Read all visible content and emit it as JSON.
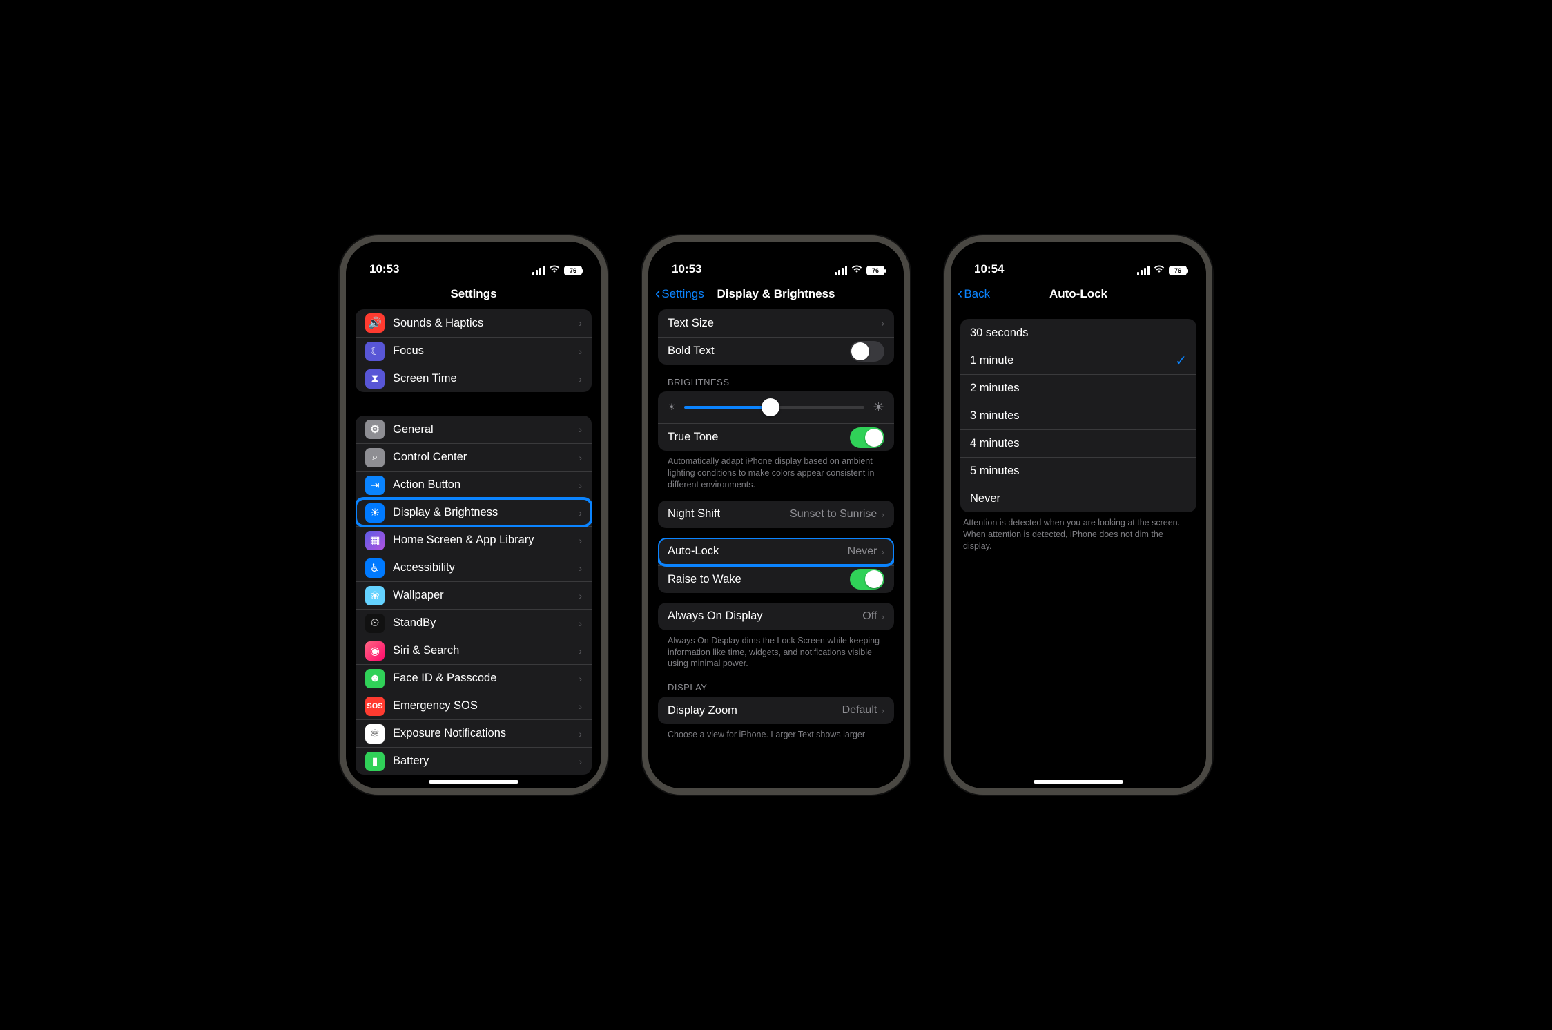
{
  "phone1": {
    "time": "10:53",
    "battery": "76",
    "title": "Settings",
    "group1": [
      {
        "label": "Sounds & Haptics",
        "icon": "🔊",
        "cls": "ic-red",
        "name": "settings-sounds"
      },
      {
        "label": "Focus",
        "icon": "☾",
        "cls": "ic-purple",
        "name": "settings-focus"
      },
      {
        "label": "Screen Time",
        "icon": "⧗",
        "cls": "ic-hourglass",
        "name": "settings-screen-time"
      }
    ],
    "group2": [
      {
        "label": "General",
        "icon": "⚙",
        "cls": "ic-grey",
        "name": "settings-general"
      },
      {
        "label": "Control Center",
        "icon": "⌕",
        "cls": "ic-grey",
        "name": "settings-control-center"
      },
      {
        "label": "Action Button",
        "icon": "⇥",
        "cls": "ic-bluebox",
        "name": "settings-action-button"
      },
      {
        "label": "Display & Brightness",
        "icon": "☀",
        "cls": "ic-blue",
        "name": "settings-display-brightness",
        "highlight": true
      },
      {
        "label": "Home Screen & App Library",
        "icon": "▦",
        "cls": "ic-grad",
        "name": "settings-home-screen"
      },
      {
        "label": "Accessibility",
        "icon": "♿︎",
        "cls": "ic-blue",
        "name": "settings-accessibility"
      },
      {
        "label": "Wallpaper",
        "icon": "❀",
        "cls": "ic-cyan",
        "name": "settings-wallpaper"
      },
      {
        "label": "StandBy",
        "icon": "⏲",
        "cls": "ic-black",
        "name": "settings-standby"
      },
      {
        "label": "Siri & Search",
        "icon": "◉",
        "cls": "ic-pink",
        "name": "settings-siri"
      },
      {
        "label": "Face ID & Passcode",
        "icon": "☻",
        "cls": "ic-green",
        "name": "settings-faceid"
      },
      {
        "label": "Emergency SOS",
        "icon": "SOS",
        "cls": "ic-sos",
        "name": "settings-sos"
      },
      {
        "label": "Exposure Notifications",
        "icon": "⚛︎",
        "cls": "ic-white",
        "name": "settings-exposure"
      },
      {
        "label": "Battery",
        "icon": "▮",
        "cls": "ic-green",
        "name": "settings-battery"
      }
    ]
  },
  "phone2": {
    "time": "10:53",
    "battery": "76",
    "back": "Settings",
    "title": "Display & Brightness",
    "text_size": "Text Size",
    "bold_text": "Bold Text",
    "brightness_header": "BRIGHTNESS",
    "brightness_pct": 48,
    "true_tone": "True Tone",
    "true_tone_footer": "Automatically adapt iPhone display based on ambient lighting conditions to make colors appear consistent in different environments.",
    "night_shift": "Night Shift",
    "night_shift_value": "Sunset to Sunrise",
    "auto_lock": "Auto-Lock",
    "auto_lock_value": "Never",
    "raise_wake": "Raise to Wake",
    "always_on": "Always On Display",
    "always_on_value": "Off",
    "always_on_footer": "Always On Display dims the Lock Screen while keeping information like time, widgets, and notifications visible using minimal power.",
    "display_header": "DISPLAY",
    "display_zoom": "Display Zoom",
    "display_zoom_value": "Default",
    "display_zoom_footer": "Choose a view for iPhone. Larger Text shows larger"
  },
  "phone3": {
    "time": "10:54",
    "battery": "76",
    "back": "Back",
    "title": "Auto-Lock",
    "options": [
      "30 seconds",
      "1 minute",
      "2 minutes",
      "3 minutes",
      "4 minutes",
      "5 minutes",
      "Never"
    ],
    "selected": "1 minute",
    "footer": "Attention is detected when you are looking at the screen. When attention is detected, iPhone does not dim the display."
  }
}
